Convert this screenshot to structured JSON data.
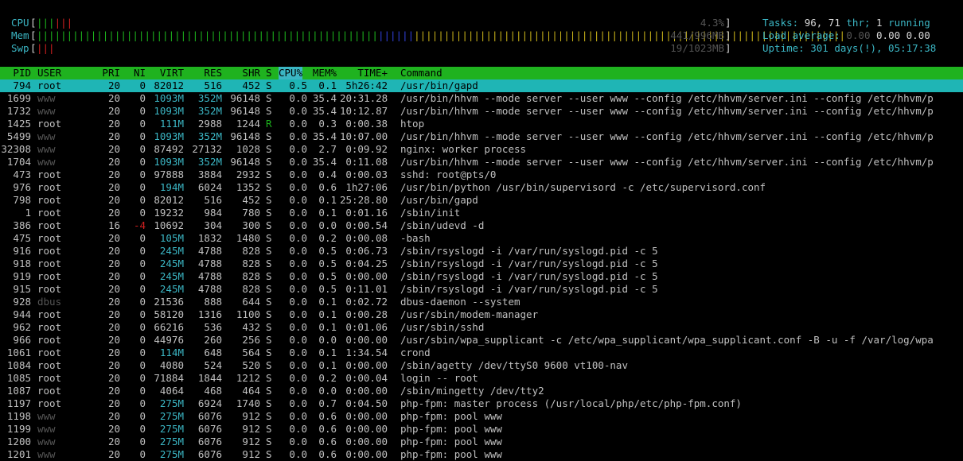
{
  "meters": {
    "cpu": {
      "label": "CPU",
      "value": "4.3%",
      "bars": [
        {
          "char": "|",
          "count": 3,
          "color": "grn"
        },
        {
          "char": "|",
          "count": 3,
          "color": "red"
        }
      ]
    },
    "mem": {
      "label": "Mem",
      "value": "441/996MB",
      "bars": [
        {
          "char": "|",
          "count": 57,
          "color": "grn"
        },
        {
          "char": "|",
          "count": 6,
          "color": "blu"
        },
        {
          "char": "|",
          "count": 72,
          "color": "yel"
        }
      ]
    },
    "swp": {
      "label": "Swp",
      "value": "19/1023MB",
      "bars": [
        {
          "char": "|",
          "count": 3,
          "color": "red"
        }
      ]
    }
  },
  "stats": {
    "tasks_label": "Tasks:",
    "tasks_value": "96,",
    "thr_value": "71",
    "thr_label": "thr;",
    "running_value": "1",
    "running_label": "running",
    "load_label": "Load average:",
    "load1": "0.00",
    "load5": "0.00",
    "load15": "0.00",
    "uptime_label": "Uptime:",
    "uptime_value": "301 days(!), 05:17:38"
  },
  "columns": [
    "PID",
    "USER",
    "PRI",
    "NI",
    "VIRT",
    "RES",
    "SHR",
    "S",
    "CPU%",
    "MEM%",
    "TIME+",
    "Command"
  ],
  "processes": [
    {
      "pid": "794",
      "user": "root",
      "pri": "20",
      "ni": "0",
      "virt": "82012",
      "res": "516",
      "shr": "452",
      "s": "S",
      "cpu": "0.5",
      "mem": "0.1",
      "time": "5h26:42",
      "cmd": "/usr/bin/gapd",
      "selected": true
    },
    {
      "pid": "1699",
      "user": "www",
      "pri": "20",
      "ni": "0",
      "virt": "1093M",
      "res": "352M",
      "shr": "96148",
      "s": "S",
      "cpu": "0.0",
      "mem": "35.4",
      "time": "20:31.28",
      "cmd": "/usr/bin/hhvm --mode server --user www --config /etc/hhvm/server.ini --config /etc/hhvm/p"
    },
    {
      "pid": "1732",
      "user": "www",
      "pri": "20",
      "ni": "0",
      "virt": "1093M",
      "res": "352M",
      "shr": "96148",
      "s": "S",
      "cpu": "0.0",
      "mem": "35.4",
      "time": "10:12.87",
      "cmd": "/usr/bin/hhvm --mode server --user www --config /etc/hhvm/server.ini --config /etc/hhvm/p"
    },
    {
      "pid": "1425",
      "user": "root",
      "pri": "20",
      "ni": "0",
      "virt": "111M",
      "res": "2988",
      "shr": "1244",
      "s": "R",
      "cpu": "0.0",
      "mem": "0.3",
      "time": "0:00.38",
      "cmd": "htop"
    },
    {
      "pid": "5499",
      "user": "www",
      "pri": "20",
      "ni": "0",
      "virt": "1093M",
      "res": "352M",
      "shr": "96148",
      "s": "S",
      "cpu": "0.0",
      "mem": "35.4",
      "time": "10:07.00",
      "cmd": "/usr/bin/hhvm --mode server --user www --config /etc/hhvm/server.ini --config /etc/hhvm/p"
    },
    {
      "pid": "32308",
      "user": "www",
      "pri": "20",
      "ni": "0",
      "virt": "87492",
      "res": "27132",
      "shr": "1028",
      "s": "S",
      "cpu": "0.0",
      "mem": "2.7",
      "time": "0:09.92",
      "cmd": "nginx: worker process"
    },
    {
      "pid": "1704",
      "user": "www",
      "pri": "20",
      "ni": "0",
      "virt": "1093M",
      "res": "352M",
      "shr": "96148",
      "s": "S",
      "cpu": "0.0",
      "mem": "35.4",
      "time": "0:11.08",
      "cmd": "/usr/bin/hhvm --mode server --user www --config /etc/hhvm/server.ini --config /etc/hhvm/p"
    },
    {
      "pid": "473",
      "user": "root",
      "pri": "20",
      "ni": "0",
      "virt": "97888",
      "res": "3884",
      "shr": "2932",
      "s": "S",
      "cpu": "0.0",
      "mem": "0.4",
      "time": "0:00.03",
      "cmd": "sshd: root@pts/0"
    },
    {
      "pid": "976",
      "user": "root",
      "pri": "20",
      "ni": "0",
      "virt": "194M",
      "res": "6024",
      "shr": "1352",
      "s": "S",
      "cpu": "0.0",
      "mem": "0.6",
      "time": "1h27:06",
      "cmd": "/usr/bin/python /usr/bin/supervisord -c /etc/supervisord.conf"
    },
    {
      "pid": "798",
      "user": "root",
      "pri": "20",
      "ni": "0",
      "virt": "82012",
      "res": "516",
      "shr": "452",
      "s": "S",
      "cpu": "0.0",
      "mem": "0.1",
      "time": "25:28.80",
      "cmd": "/usr/bin/gapd"
    },
    {
      "pid": "1",
      "user": "root",
      "pri": "20",
      "ni": "0",
      "virt": "19232",
      "res": "984",
      "shr": "780",
      "s": "S",
      "cpu": "0.0",
      "mem": "0.1",
      "time": "0:01.16",
      "cmd": "/sbin/init"
    },
    {
      "pid": "386",
      "user": "root",
      "pri": "16",
      "ni": "-4",
      "virt": "10692",
      "res": "304",
      "shr": "300",
      "s": "S",
      "cpu": "0.0",
      "mem": "0.0",
      "time": "0:00.54",
      "cmd": "/sbin/udevd -d"
    },
    {
      "pid": "475",
      "user": "root",
      "pri": "20",
      "ni": "0",
      "virt": "105M",
      "res": "1832",
      "shr": "1480",
      "s": "S",
      "cpu": "0.0",
      "mem": "0.2",
      "time": "0:00.08",
      "cmd": "-bash"
    },
    {
      "pid": "916",
      "user": "root",
      "pri": "20",
      "ni": "0",
      "virt": "245M",
      "res": "4788",
      "shr": "828",
      "s": "S",
      "cpu": "0.0",
      "mem": "0.5",
      "time": "0:06.73",
      "cmd": "/sbin/rsyslogd -i /var/run/syslogd.pid -c 5"
    },
    {
      "pid": "918",
      "user": "root",
      "pri": "20",
      "ni": "0",
      "virt": "245M",
      "res": "4788",
      "shr": "828",
      "s": "S",
      "cpu": "0.0",
      "mem": "0.5",
      "time": "0:04.25",
      "cmd": "/sbin/rsyslogd -i /var/run/syslogd.pid -c 5"
    },
    {
      "pid": "919",
      "user": "root",
      "pri": "20",
      "ni": "0",
      "virt": "245M",
      "res": "4788",
      "shr": "828",
      "s": "S",
      "cpu": "0.0",
      "mem": "0.5",
      "time": "0:00.00",
      "cmd": "/sbin/rsyslogd -i /var/run/syslogd.pid -c 5"
    },
    {
      "pid": "915",
      "user": "root",
      "pri": "20",
      "ni": "0",
      "virt": "245M",
      "res": "4788",
      "shr": "828",
      "s": "S",
      "cpu": "0.0",
      "mem": "0.5",
      "time": "0:11.01",
      "cmd": "/sbin/rsyslogd -i /var/run/syslogd.pid -c 5"
    },
    {
      "pid": "928",
      "user": "dbus",
      "pri": "20",
      "ni": "0",
      "virt": "21536",
      "res": "888",
      "shr": "644",
      "s": "S",
      "cpu": "0.0",
      "mem": "0.1",
      "time": "0:02.72",
      "cmd": "dbus-daemon --system"
    },
    {
      "pid": "944",
      "user": "root",
      "pri": "20",
      "ni": "0",
      "virt": "58120",
      "res": "1316",
      "shr": "1100",
      "s": "S",
      "cpu": "0.0",
      "mem": "0.1",
      "time": "0:00.28",
      "cmd": "/usr/sbin/modem-manager"
    },
    {
      "pid": "962",
      "user": "root",
      "pri": "20",
      "ni": "0",
      "virt": "66216",
      "res": "536",
      "shr": "432",
      "s": "S",
      "cpu": "0.0",
      "mem": "0.1",
      "time": "0:01.06",
      "cmd": "/usr/sbin/sshd"
    },
    {
      "pid": "966",
      "user": "root",
      "pri": "20",
      "ni": "0",
      "virt": "44976",
      "res": "260",
      "shr": "256",
      "s": "S",
      "cpu": "0.0",
      "mem": "0.0",
      "time": "0:00.00",
      "cmd": "/usr/sbin/wpa_supplicant -c /etc/wpa_supplicant/wpa_supplicant.conf -B -u -f /var/log/wpa"
    },
    {
      "pid": "1061",
      "user": "root",
      "pri": "20",
      "ni": "0",
      "virt": "114M",
      "res": "648",
      "shr": "564",
      "s": "S",
      "cpu": "0.0",
      "mem": "0.1",
      "time": "1:34.54",
      "cmd": "crond"
    },
    {
      "pid": "1084",
      "user": "root",
      "pri": "20",
      "ni": "0",
      "virt": "4080",
      "res": "524",
      "shr": "520",
      "s": "S",
      "cpu": "0.0",
      "mem": "0.1",
      "time": "0:00.00",
      "cmd": "/sbin/agetty /dev/ttyS0 9600 vt100-nav"
    },
    {
      "pid": "1085",
      "user": "root",
      "pri": "20",
      "ni": "0",
      "virt": "71884",
      "res": "1844",
      "shr": "1212",
      "s": "S",
      "cpu": "0.0",
      "mem": "0.2",
      "time": "0:00.04",
      "cmd": "login -- root"
    },
    {
      "pid": "1087",
      "user": "root",
      "pri": "20",
      "ni": "0",
      "virt": "4064",
      "res": "468",
      "shr": "464",
      "s": "S",
      "cpu": "0.0",
      "mem": "0.0",
      "time": "0:00.00",
      "cmd": "/sbin/mingetty /dev/tty2"
    },
    {
      "pid": "1197",
      "user": "root",
      "pri": "20",
      "ni": "0",
      "virt": "275M",
      "res": "6924",
      "shr": "1740",
      "s": "S",
      "cpu": "0.0",
      "mem": "0.7",
      "time": "0:04.50",
      "cmd": "php-fpm: master process (/usr/local/php/etc/php-fpm.conf)"
    },
    {
      "pid": "1198",
      "user": "www",
      "pri": "20",
      "ni": "0",
      "virt": "275M",
      "res": "6076",
      "shr": "912",
      "s": "S",
      "cpu": "0.0",
      "mem": "0.6",
      "time": "0:00.00",
      "cmd": "php-fpm: pool www"
    },
    {
      "pid": "1199",
      "user": "www",
      "pri": "20",
      "ni": "0",
      "virt": "275M",
      "res": "6076",
      "shr": "912",
      "s": "S",
      "cpu": "0.0",
      "mem": "0.6",
      "time": "0:00.00",
      "cmd": "php-fpm: pool www"
    },
    {
      "pid": "1200",
      "user": "www",
      "pri": "20",
      "ni": "0",
      "virt": "275M",
      "res": "6076",
      "shr": "912",
      "s": "S",
      "cpu": "0.0",
      "mem": "0.6",
      "time": "0:00.00",
      "cmd": "php-fpm: pool www"
    },
    {
      "pid": "1201",
      "user": "www",
      "pri": "20",
      "ni": "0",
      "virt": "275M",
      "res": "6076",
      "shr": "912",
      "s": "S",
      "cpu": "0.0",
      "mem": "0.6",
      "time": "0:00.00",
      "cmd": "php-fpm: pool www"
    }
  ]
}
